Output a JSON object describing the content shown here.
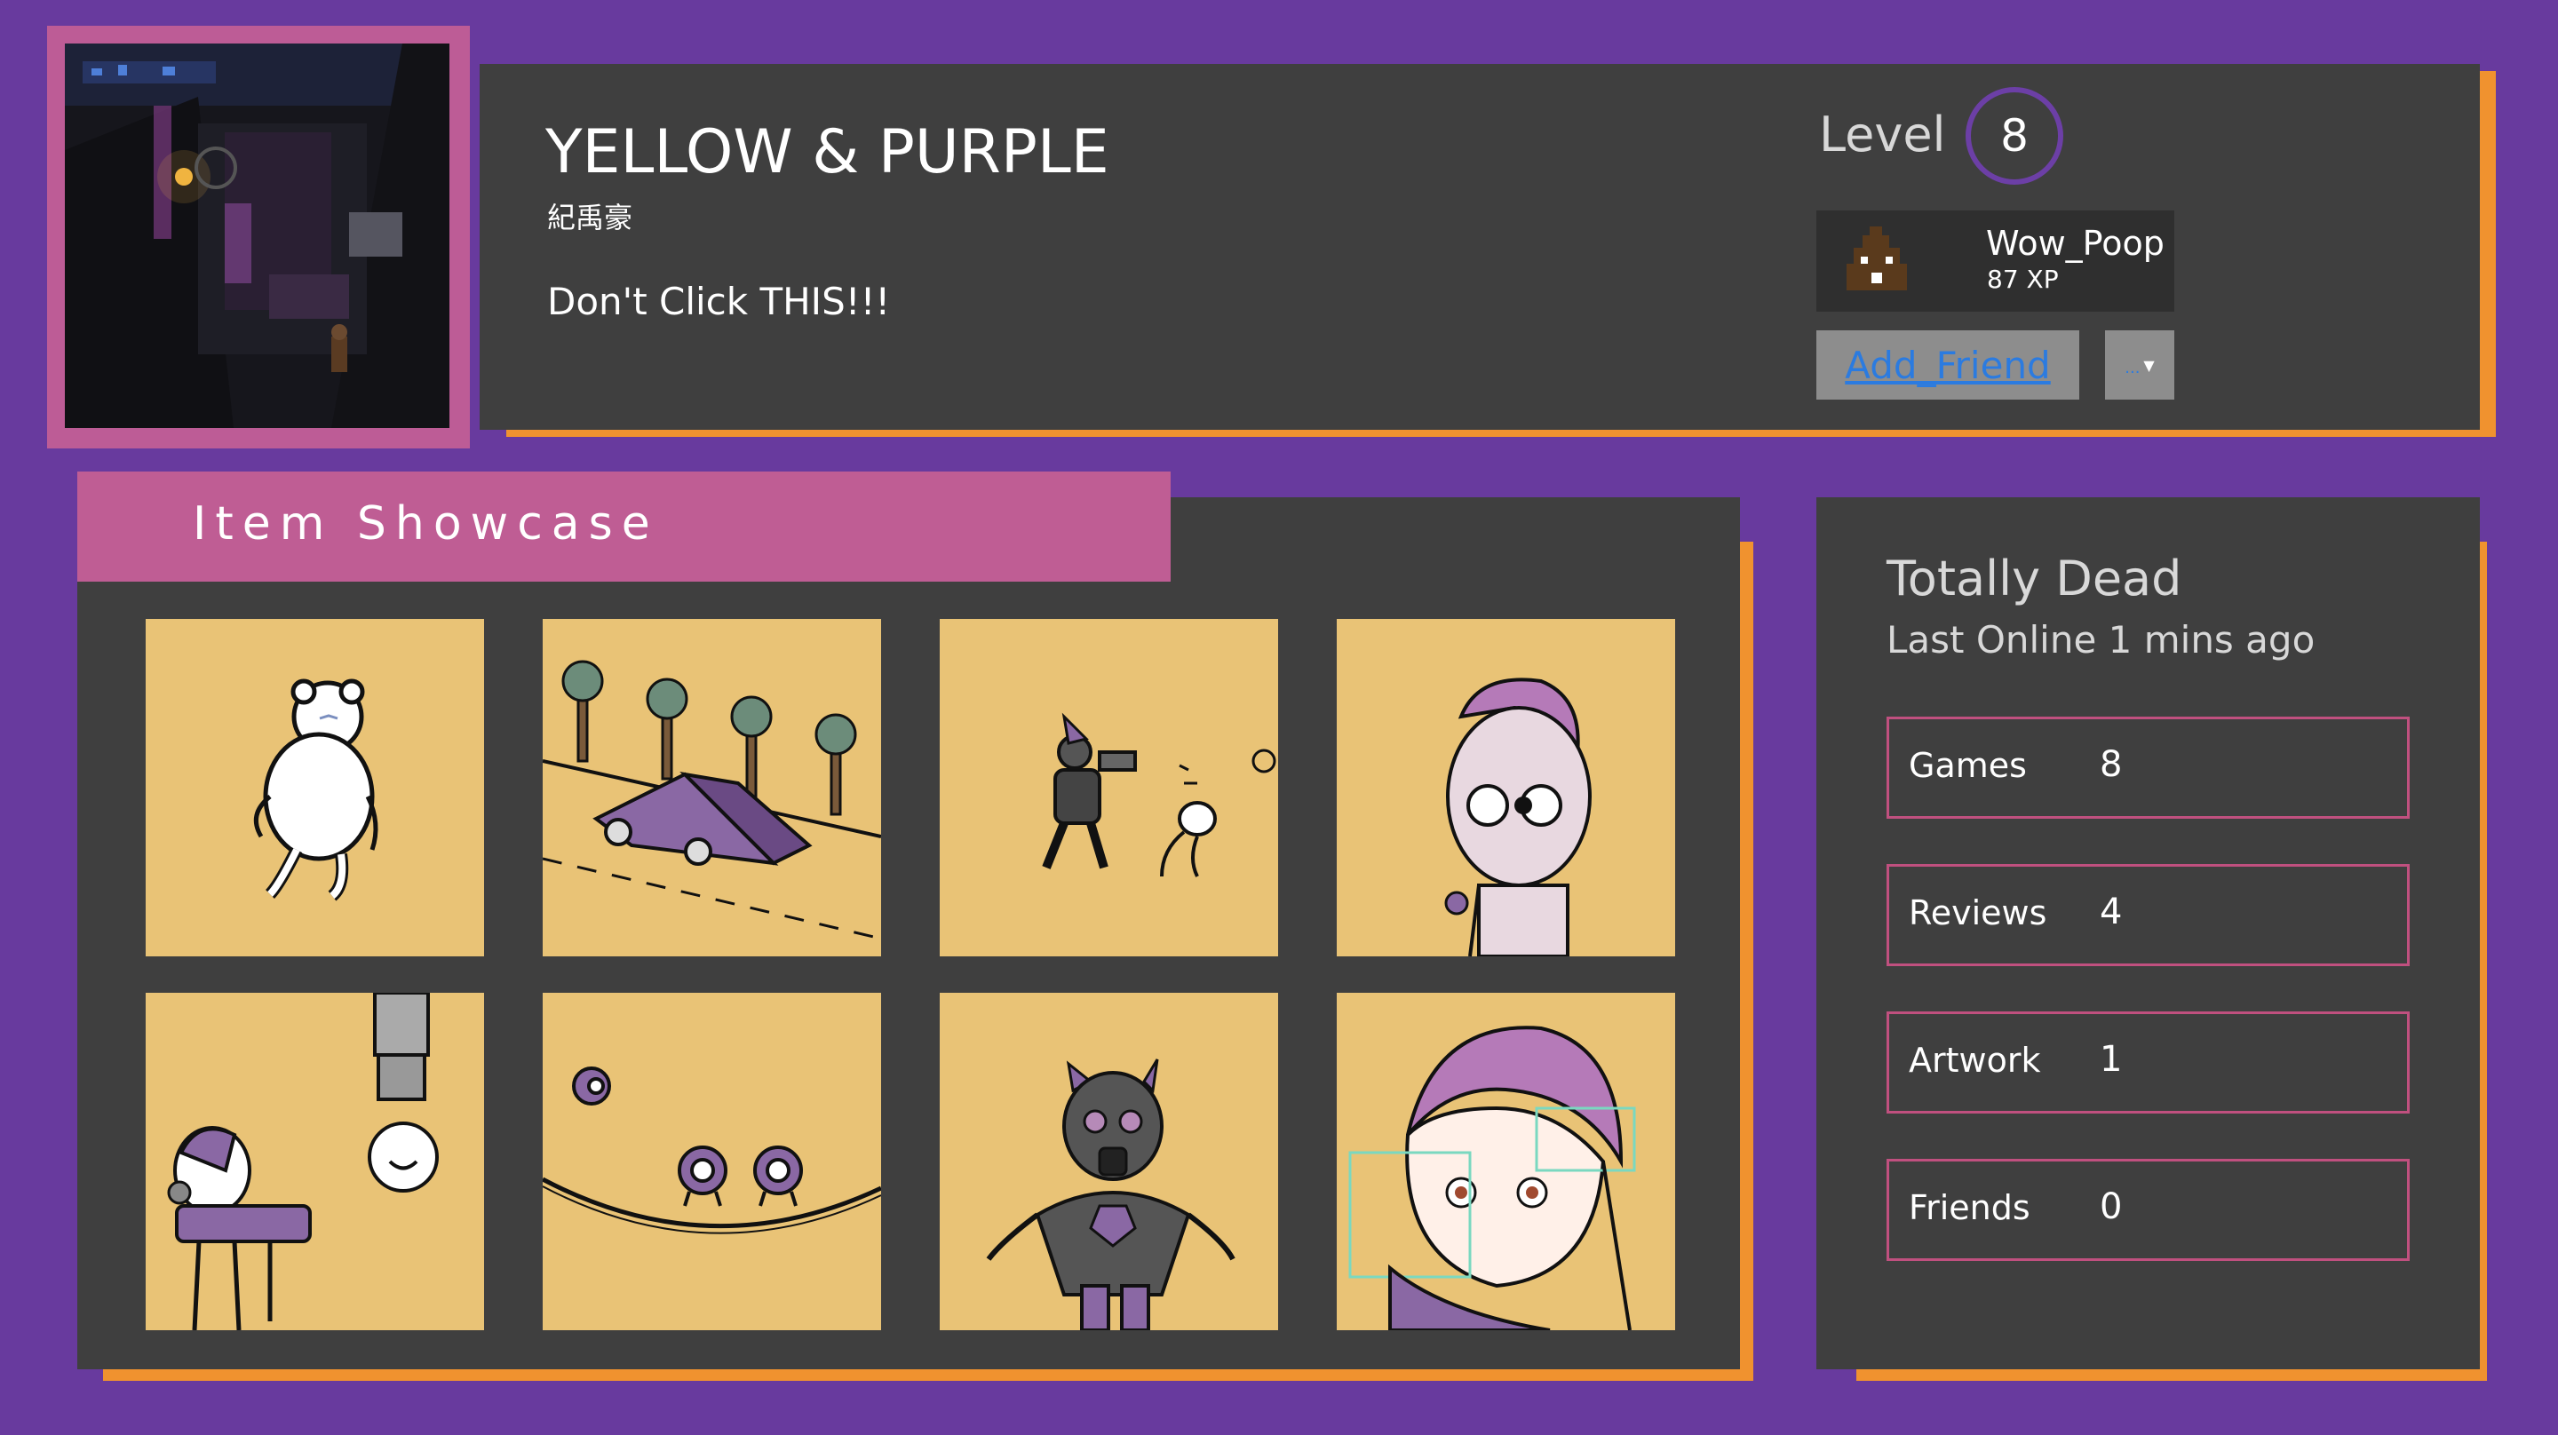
{
  "profile": {
    "name": "YELLOW & PURPLE",
    "subname": "紀禹豪",
    "summary": "Don't Click THIS!!!",
    "avatar_icon": "dark-city-scene-avatar"
  },
  "level": {
    "label": "Level",
    "value": "8"
  },
  "badge": {
    "name": "Wow_Poop",
    "xp": "87 XP",
    "icon": "poop-icon"
  },
  "actions": {
    "add_friend": "Add_Friend",
    "more": "..."
  },
  "showcase": {
    "title": "Item Showcase",
    "items": [
      "bear-character-art",
      "car-ramp-palm-trees-art",
      "robot-chasing-creature-art",
      "cyborg-face-art",
      "girl-with-robot-arm-art",
      "eyeball-creatures-art",
      "gas-mask-robot-art",
      "hologram-girl-art"
    ]
  },
  "status": {
    "title": "Totally Dead",
    "last_online": "Last Online 1 mins ago"
  },
  "stats": [
    {
      "label": "Games",
      "value": "8"
    },
    {
      "label": "Reviews",
      "value": "4"
    },
    {
      "label": "Artwork",
      "value": "1"
    },
    {
      "label": "Friends",
      "value": "0"
    }
  ],
  "colors": {
    "background": "#683a9e",
    "panel": "#3f3f3f",
    "accent_pink": "#bf5d94",
    "accent_orange": "#f0922f",
    "tile_yellow": "#e9c376",
    "level_ring": "#6c3fa6",
    "link_blue": "#2b7be0"
  }
}
